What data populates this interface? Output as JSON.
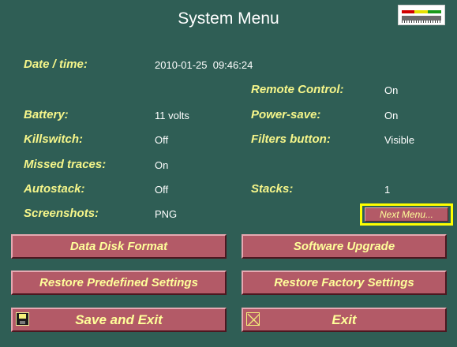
{
  "header": {
    "title": "System Menu",
    "meter_icon": "signal-level-meter-icon"
  },
  "settings": {
    "datetime": {
      "label": "Date / time:",
      "value": "2010-01-25  09:46:24"
    },
    "remote_control": {
      "label": "Remote Control:",
      "value": "On"
    },
    "battery": {
      "label": "Battery:",
      "value": "11 volts"
    },
    "power_save": {
      "label": "Power-save:",
      "value": "On"
    },
    "killswitch": {
      "label": "Killswitch:",
      "value": "Off"
    },
    "filters_button": {
      "label": "Filters button:",
      "value": "Visible"
    },
    "missed_traces": {
      "label": "Missed traces:",
      "value": "On"
    },
    "autostack": {
      "label": "Autostack:",
      "value": "Off"
    },
    "stacks": {
      "label": "Stacks:",
      "value": "1"
    },
    "screenshots": {
      "label": "Screenshots:",
      "value": "PNG"
    }
  },
  "buttons": {
    "next_menu": "Next Menu...",
    "data_disk_format": "Data Disk Format",
    "software_upgrade": "Software Upgrade",
    "restore_predefined": "Restore Predefined Settings",
    "restore_factory": "Restore Factory Settings",
    "save_and_exit": "Save and Exit",
    "exit": "Exit"
  },
  "colors": {
    "background": "#2f5e55",
    "label": "#f6f68a",
    "button": "#b35a67",
    "button_text": "#ffff9a",
    "focus_outline": "#ffff00"
  },
  "icons": {
    "save": "floppy-disk-icon",
    "exit": "close-x-icon"
  }
}
